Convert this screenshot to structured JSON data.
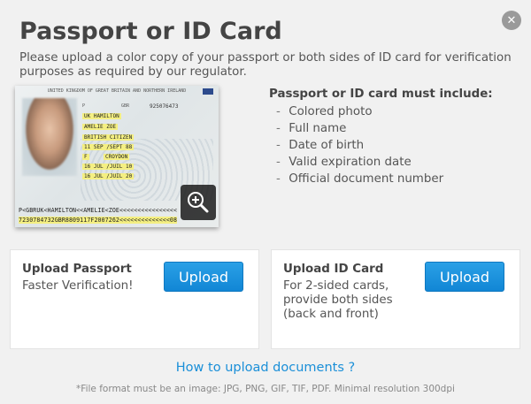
{
  "modal": {
    "title": "Passport or ID Card",
    "description": "Please upload a color copy of your passport or both sides of ID card for verification purposes as required by our regulator.",
    "close_icon": "close-icon"
  },
  "sample_passport": {
    "header": "UNITED KINGDOM OF GREAT BRITAIN AND NORTHERN IRELAND",
    "type": "P",
    "code": "GBR",
    "number": "925076473",
    "surname": "UK HAMILTON",
    "given_names": "AMELIE ZOE",
    "nationality": "BRITISH CITIZEN",
    "date_of_birth": "11 SEP /SEPT 88",
    "sex": "F",
    "place_of_birth": "CROYDON",
    "date_of_issue": "16 JUL /JUIL 10",
    "date_of_expiry": "16 JUL /JUIL 20",
    "mrz_line1": "P<GBRUK<HAMILTON<<AMELIE<ZOE<<<<<<<<<<<<<<<<",
    "mrz_line2": "7230784732GBR8809117F2007262<<<<<<<<<<<<<<08",
    "zoom_icon": "zoom-in-icon"
  },
  "requirements": {
    "title": "Passport or ID card must include:",
    "items": [
      "Colored photo",
      "Full name",
      "Date of birth",
      "Valid expiration date",
      "Official document number"
    ]
  },
  "upload_cards": [
    {
      "title": "Upload Passport",
      "subtitle": "Faster Verification!",
      "button_label": "Upload"
    },
    {
      "title": "Upload ID Card",
      "subtitle": "For 2-sided cards, provide both sides (back and front)",
      "button_label": "Upload"
    }
  ],
  "help_link": "How to upload documents ?",
  "footnote": "*File format must be an image: JPG, PNG, GIF, TIF, PDF. Minimal resolution 300dpi",
  "colors": {
    "accent": "#1a8fd8",
    "button": "#1186d5",
    "highlight": "#f4ef82"
  }
}
